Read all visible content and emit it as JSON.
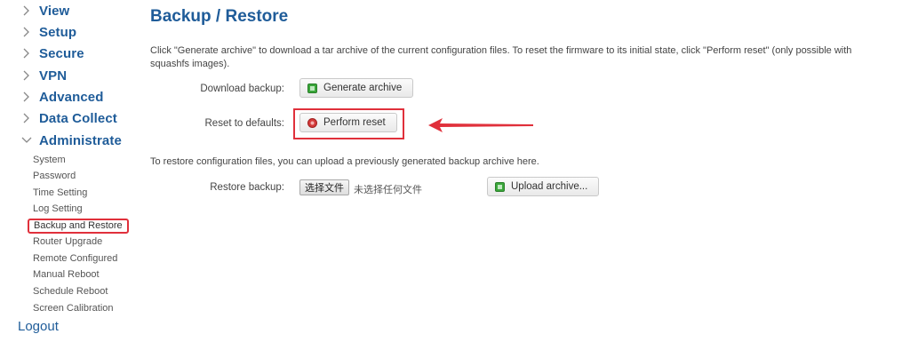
{
  "sidebar": {
    "items": [
      {
        "label": "View",
        "expanded": false
      },
      {
        "label": "Setup",
        "expanded": false
      },
      {
        "label": "Secure",
        "expanded": false
      },
      {
        "label": "VPN",
        "expanded": false
      },
      {
        "label": "Advanced",
        "expanded": false
      },
      {
        "label": "Data Collect",
        "expanded": false
      },
      {
        "label": "Administrate",
        "expanded": true
      }
    ],
    "subitems": [
      "System",
      "Password",
      "Time Setting",
      "Log Setting",
      "Backup and Restore",
      "Router Upgrade",
      "Remote Configured",
      "Manual Reboot",
      "Schedule Reboot",
      "Screen Calibration"
    ],
    "active_subitem": "Backup and Restore",
    "logout": "Logout"
  },
  "main": {
    "title": "Backup / Restore",
    "description": "Click \"Generate archive\" to download a tar archive of the current configuration files. To reset the firmware to its initial state, click \"Perform reset\" (only possible with squashfs images).",
    "download_label": "Download backup:",
    "generate_button": "Generate archive",
    "reset_label": "Reset to defaults:",
    "reset_button": "Perform reset",
    "restore_description": "To restore configuration files, you can upload a previously generated backup archive here.",
    "restore_label": "Restore backup:",
    "file_button": "选择文件",
    "file_status": "未选择任何文件",
    "upload_button": "Upload archive..."
  },
  "colors": {
    "link": "#1f5c99",
    "highlight": "#e0303b",
    "green_icon": "#3aa63a",
    "red_icon": "#d33a3a"
  }
}
